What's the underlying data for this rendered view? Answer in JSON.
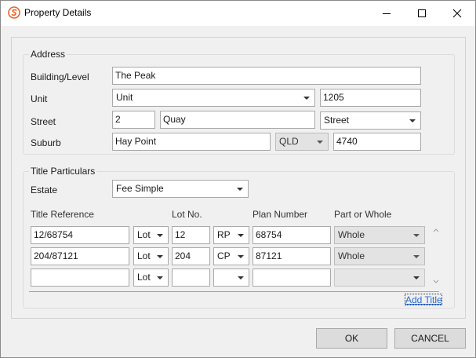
{
  "window": {
    "title": "Property Details",
    "icon": "app-logo-icon"
  },
  "address": {
    "group_title": "Address",
    "building_label": "Building/Level",
    "building_value": "The Peak",
    "unit_label": "Unit",
    "unit_type": "Unit",
    "unit_number": "1205",
    "street_label": "Street",
    "street_number": "2",
    "street_name": "Quay",
    "street_type": "Street",
    "suburb_label": "Suburb",
    "suburb_value": "Hay Point",
    "state": "QLD",
    "postcode": "4740"
  },
  "title_particulars": {
    "group_title": "Title Particulars",
    "estate_label": "Estate",
    "estate_value": "Fee Simple",
    "columns": {
      "title_reference": "Title Reference",
      "lot_no": "Lot No.",
      "plan_number": "Plan Number",
      "part_or_whole": "Part or Whole"
    },
    "rows": [
      {
        "title_reference": "12/68754",
        "lot_type": "Lot",
        "lot_no": "12",
        "plan_type": "RP",
        "plan_number": "68754",
        "part_or_whole": "Whole"
      },
      {
        "title_reference": "204/87121",
        "lot_type": "Lot",
        "lot_no": "204",
        "plan_type": "CP",
        "plan_number": "87121",
        "part_or_whole": "Whole"
      },
      {
        "title_reference": "",
        "lot_type": "Lot",
        "lot_no": "",
        "plan_type": "",
        "plan_number": "",
        "part_or_whole": ""
      }
    ],
    "add_title_label": "Add Title"
  },
  "footer": {
    "ok_label": "OK",
    "cancel_label": "CANCEL"
  }
}
